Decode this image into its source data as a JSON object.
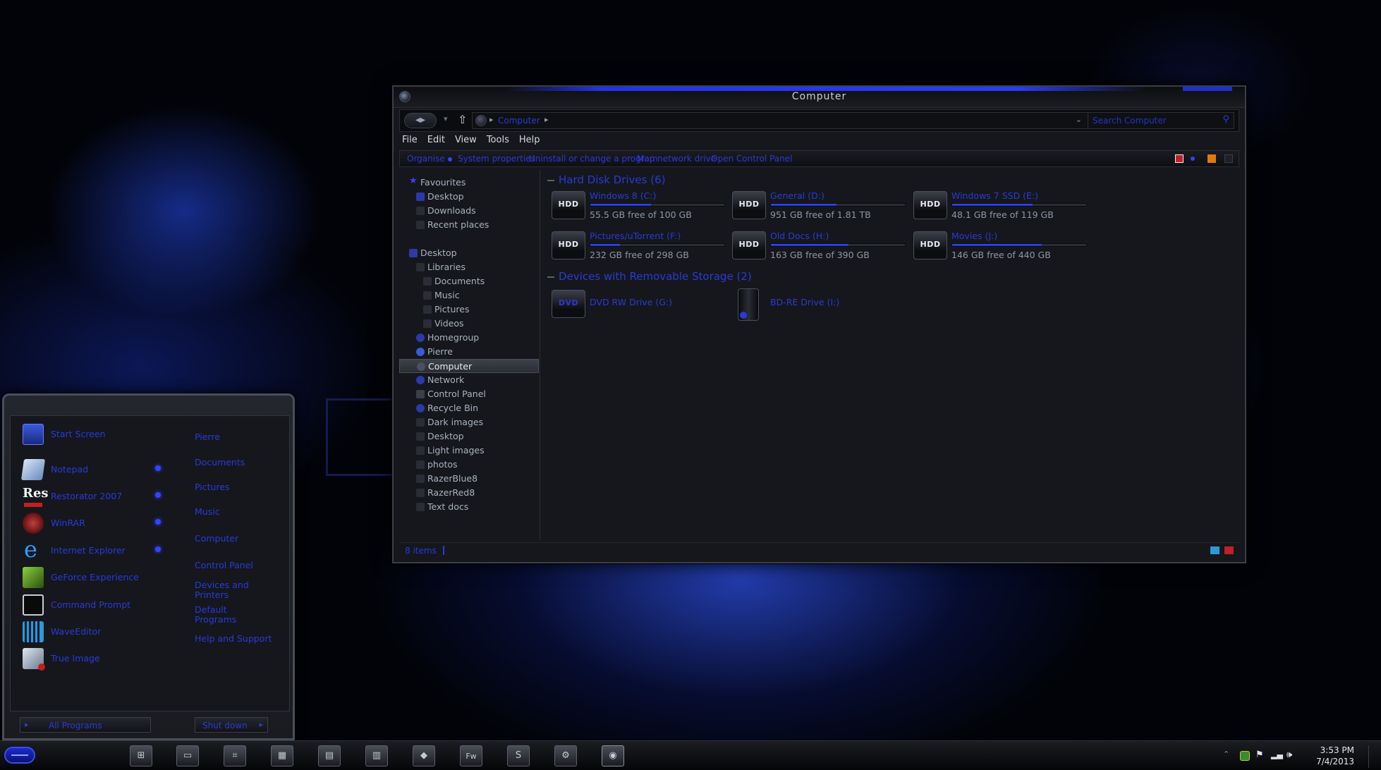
{
  "explorer": {
    "title": "Computer",
    "address_path": "Computer",
    "search_placeholder": "Search Computer",
    "menu": [
      "File",
      "Edit",
      "View",
      "Tools",
      "Help"
    ],
    "commands": {
      "organise": "Organise",
      "system_properties": "System properties",
      "uninstall": "Uninstall or change a program",
      "map_drive": "Map network drive",
      "control_panel": "Open Control Panel"
    },
    "nav": {
      "favourites": "Favourites",
      "fav_desktop": "Desktop",
      "downloads": "Downloads",
      "recent": "Recent places",
      "desktop": "Desktop",
      "libraries": "Libraries",
      "documents": "Documents",
      "music": "Music",
      "pictures": "Pictures",
      "videos": "Videos",
      "homegroup": "Homegroup",
      "user": "Pierre",
      "computer": "Computer",
      "network": "Network",
      "control_panel": "Control Panel",
      "recycle_bin": "Recycle Bin",
      "dark_images": "Dark images",
      "desktop2": "Desktop",
      "light_images": "Light images",
      "photos": "photos",
      "razer_blue": "RazerBlue8",
      "razer_red": "RazerRed8",
      "text_docs": "Text docs"
    },
    "groups": {
      "hdd": "Hard Disk Drives (6)",
      "removable": "Devices with Removable Storage (2)"
    },
    "drives": [
      {
        "name": "Windows 8 (C:)",
        "free": "55.5 GB free of 100 GB",
        "used": 0.45,
        "icon": "HDD"
      },
      {
        "name": "General (D:)",
        "free": "951 GB free of 1.81 TB",
        "used": 0.49,
        "icon": "HDD"
      },
      {
        "name": "Windows 7 SSD (E:)",
        "free": "48.1 GB free of 119 GB",
        "used": 0.6,
        "icon": "HDD"
      },
      {
        "name": "Pictures/uTorrent (F:)",
        "free": "232 GB free of 298 GB",
        "used": 0.22,
        "icon": "HDD"
      },
      {
        "name": "Old Docs (H:)",
        "free": "163 GB free of 390 GB",
        "used": 0.58,
        "icon": "HDD"
      },
      {
        "name": "Movies (J:)",
        "free": "146 GB free of 440 GB",
        "used": 0.67,
        "icon": "HDD"
      }
    ],
    "devices": [
      {
        "name": "DVD RW Drive (G:)",
        "icon": "DVD"
      },
      {
        "name": "BD-RE Drive (I:)",
        "icon": "BD"
      }
    ],
    "status_count": "8 items"
  },
  "start_menu": {
    "pinned": [
      {
        "label": "Start Screen",
        "icon": "start-screen-icon"
      },
      {
        "label": "Notepad",
        "icon": "notepad-icon"
      },
      {
        "label": "Restorator 2007",
        "icon": "restorator-icon"
      },
      {
        "label": "WinRAR",
        "icon": "winrar-icon"
      },
      {
        "label": "Internet Explorer",
        "icon": "internet-explorer-icon"
      },
      {
        "label": "GeForce Experience",
        "icon": "geforce-icon"
      },
      {
        "label": "Command Prompt",
        "icon": "command-prompt-icon"
      },
      {
        "label": "WaveEditor",
        "icon": "wave-editor-icon"
      },
      {
        "label": "True Image",
        "icon": "true-image-icon"
      }
    ],
    "res_badge": "Res",
    "right_links": [
      "Pierre",
      "Documents",
      "Pictures",
      "Music",
      "Computer",
      "Control Panel",
      "Devices and Printers",
      "Default Programs",
      "Help and Support"
    ],
    "all_programs": "All Programs",
    "shutdown": "Shut down"
  },
  "taskbar": {
    "time": "3:53 PM",
    "date": "7/4/2013"
  },
  "colors": {
    "accent": "#2a3ad8",
    "window_bg": "#15171c",
    "text_grey": "#8d96a6"
  }
}
